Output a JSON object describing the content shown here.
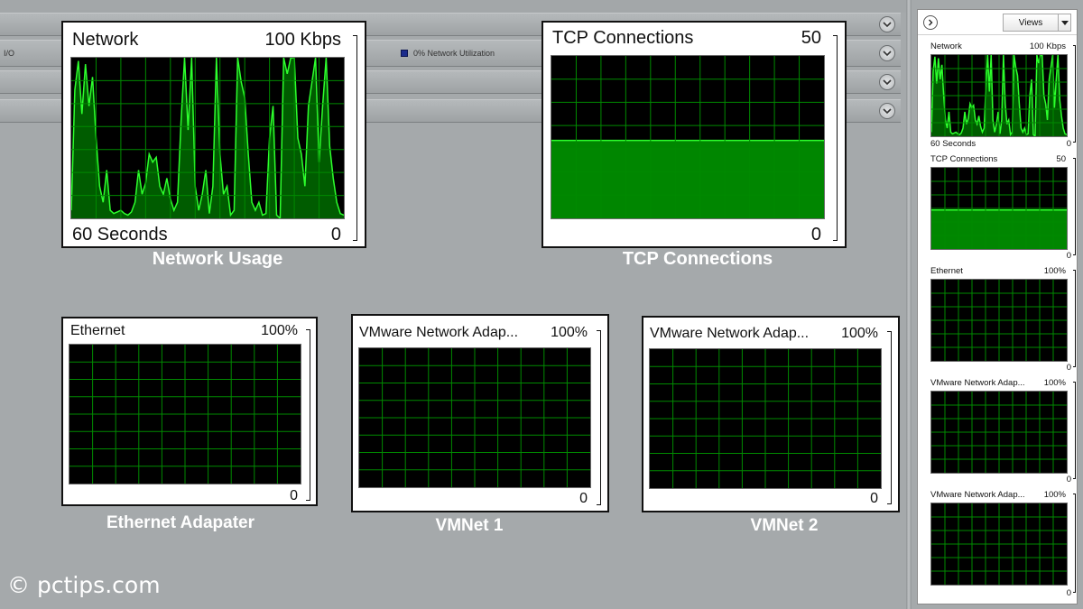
{
  "toolbar": {
    "io_label": "I/O",
    "network_utilization": "0% Network Utilization",
    "utilization_color": "#1c2c8c"
  },
  "colors": {
    "graph_bg": "#000000",
    "grid": "#008a00",
    "line": "#2dff2d",
    "fill": "#00a800"
  },
  "graphs": {
    "network": {
      "title": "Network",
      "max": "100 Kbps",
      "footer": "60 Seconds",
      "min": "0",
      "caption": "Network Usage"
    },
    "tcp": {
      "title": "TCP Connections",
      "max": "50",
      "min": "0",
      "caption": "TCP Connections",
      "level": 0.48
    },
    "ethernet": {
      "title": "Ethernet",
      "max": "100%",
      "min": "0",
      "caption": "Ethernet Adapater"
    },
    "vmnet1": {
      "title": "VMware Network Adap...",
      "max": "100%",
      "min": "0",
      "caption": "VMNet 1"
    },
    "vmnet2": {
      "title": "VMware Network Adap...",
      "max": "100%",
      "min": "0",
      "caption": "VMNet 2"
    }
  },
  "network_series": [
    5,
    80,
    98,
    65,
    96,
    70,
    88,
    50,
    20,
    10,
    30,
    5,
    3,
    4,
    5,
    3,
    2,
    4,
    10,
    30,
    15,
    22,
    40,
    35,
    38,
    20,
    15,
    25,
    12,
    5,
    10,
    60,
    100,
    55,
    100,
    20,
    5,
    15,
    30,
    3,
    20,
    100,
    40,
    15,
    20,
    2,
    5,
    100,
    85,
    75,
    40,
    10,
    5,
    10,
    2,
    3,
    50,
    70,
    2,
    0,
    100,
    90,
    100,
    100,
    50,
    40,
    20,
    70,
    85,
    100,
    35,
    70,
    100,
    45,
    25,
    10,
    3,
    2
  ],
  "sidebar": {
    "views_label": "Views",
    "graphs": [
      {
        "title": "Network",
        "max": "100 Kbps",
        "footer": "60 Seconds",
        "min": "0"
      },
      {
        "title": "TCP Connections",
        "max": "50",
        "min": "0"
      },
      {
        "title": "Ethernet",
        "max": "100%",
        "min": "0"
      },
      {
        "title": "VMware Network Adap...",
        "max": "100%",
        "min": "0"
      },
      {
        "title": "VMware Network Adap...",
        "max": "100%",
        "min": "0"
      }
    ]
  },
  "watermark": "© pctips.com"
}
